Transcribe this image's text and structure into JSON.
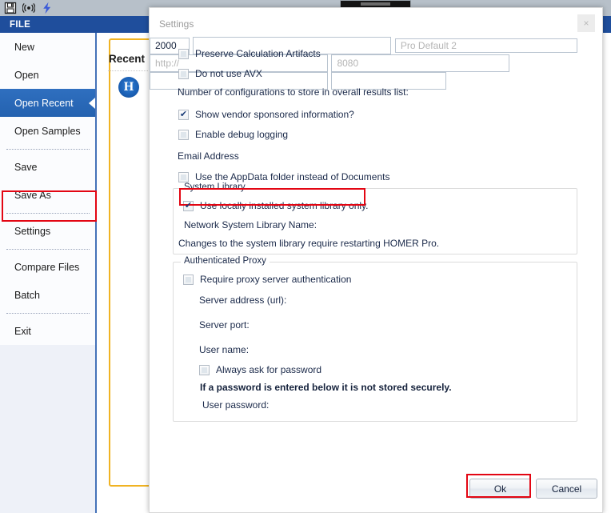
{
  "app": {
    "quick_access": [
      {
        "name": "save-icon",
        "glyph": "save"
      },
      {
        "name": "wireless-icon",
        "glyph": "wireless"
      },
      {
        "name": "lightning-icon",
        "glyph": "lightning"
      }
    ],
    "file_tab_label": "FILE",
    "recent": {
      "title": "Recent",
      "logo_letter": "H"
    },
    "backstage_items": [
      {
        "label": "New",
        "selected": false,
        "sep_after": false
      },
      {
        "label": "Open",
        "selected": false,
        "sep_after": false
      },
      {
        "label": "Open Recent",
        "selected": true,
        "sep_after": false
      },
      {
        "label": "Open Samples",
        "selected": false,
        "sep_after": true
      },
      {
        "label": "Save",
        "selected": false,
        "sep_after": false
      },
      {
        "label": "Save As",
        "selected": false,
        "sep_after": true
      },
      {
        "label": "Settings",
        "selected": false,
        "sep_after": true,
        "highlighted": true
      },
      {
        "label": "Compare Files",
        "selected": false,
        "sep_after": false
      },
      {
        "label": "Batch",
        "selected": false,
        "sep_after": true
      },
      {
        "label": "Exit",
        "selected": false,
        "sep_after": false
      }
    ]
  },
  "dialog": {
    "title": "Settings",
    "close_label": "×",
    "options": {
      "preserve_calculation_artifacts": {
        "label": "Preserve Calculation Artifacts",
        "checked": false
      },
      "do_not_use_avx": {
        "label": "Do not use AVX",
        "checked": false
      },
      "num_configurations": {
        "label": "Number of configurations to store in overall results list:",
        "value": "2000"
      },
      "show_vendor_sponsored": {
        "label": "Show vendor sponsored information?",
        "checked": true
      },
      "enable_debug_logging": {
        "label": "Enable debug logging",
        "checked": false
      },
      "email_address": {
        "label": "Email Address",
        "value": "",
        "placeholder": ""
      },
      "use_appdata_folder": {
        "label": "Use the AppData folder instead of Documents",
        "checked": false
      }
    },
    "system_library": {
      "group_title": "System Library",
      "use_local_only": {
        "label": "Use locally installed system library only.",
        "checked": true
      },
      "network_name_label": "Network System Library Name:",
      "network_name_value": "",
      "network_name_placeholder": "Pro Default 2",
      "note": "Changes to the system library require restarting HOMER Pro."
    },
    "authenticated_proxy": {
      "group_title": "Authenticated Proxy",
      "require_auth": {
        "label": "Require proxy server authentication",
        "checked": false
      },
      "server_address": {
        "label": "Server address (url):",
        "value": "",
        "placeholder": "http://"
      },
      "server_port": {
        "label": "Server port:",
        "value": "",
        "placeholder": "8080"
      },
      "user_name": {
        "label": "User name:",
        "value": "",
        "placeholder": ""
      },
      "always_ask_password": {
        "label": "Always ask for password",
        "checked": false
      },
      "warning": "If a password is entered below it is not stored securely.",
      "user_password": {
        "label": "User password:",
        "value": "",
        "placeholder": ""
      }
    },
    "buttons": {
      "ok": "Ok",
      "cancel": "Cancel"
    }
  },
  "annotations": {
    "color": "#e30613",
    "boxes": [
      "settings-menu-item",
      "use-local-library-checkbox",
      "ok-button"
    ]
  }
}
